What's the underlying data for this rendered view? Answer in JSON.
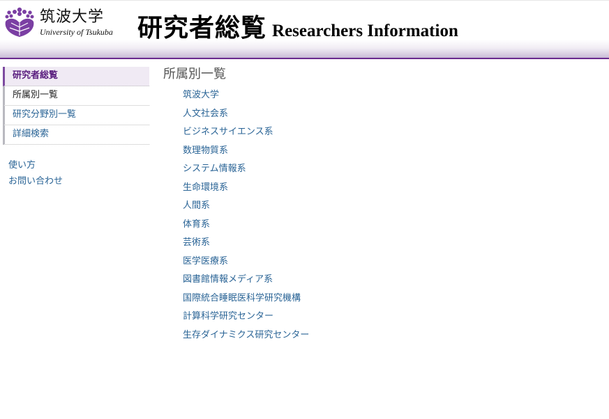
{
  "header": {
    "university_ja": "筑波大学",
    "university_en": "University of Tsukuba",
    "site_title_ja": "研究者総覧",
    "site_title_en": "Researchers Information",
    "logo_icon": "paulownia-crest-icon",
    "brand_color": "#6a2a8e"
  },
  "sidebar": {
    "nav": [
      {
        "label": "研究者総覧"
      },
      {
        "label": "所属別一覧"
      },
      {
        "label": "研究分野別一覧"
      },
      {
        "label": "詳細検索"
      }
    ],
    "links": [
      {
        "label": "使い方"
      },
      {
        "label": "お問い合わせ"
      }
    ]
  },
  "main": {
    "title": "所属別一覧",
    "organizations": [
      "筑波大学",
      "人文社会系",
      "ビジネスサイエンス系",
      "数理物質系",
      "システム情報系",
      "生命環境系",
      "人間系",
      "体育系",
      "芸術系",
      "医学医療系",
      "図書館情報メディア系",
      "国際統合睡眠医科学研究機構",
      "計算科学研究センター",
      "生存ダイナミクス研究センター"
    ],
    "link_color": "#2a6496"
  }
}
